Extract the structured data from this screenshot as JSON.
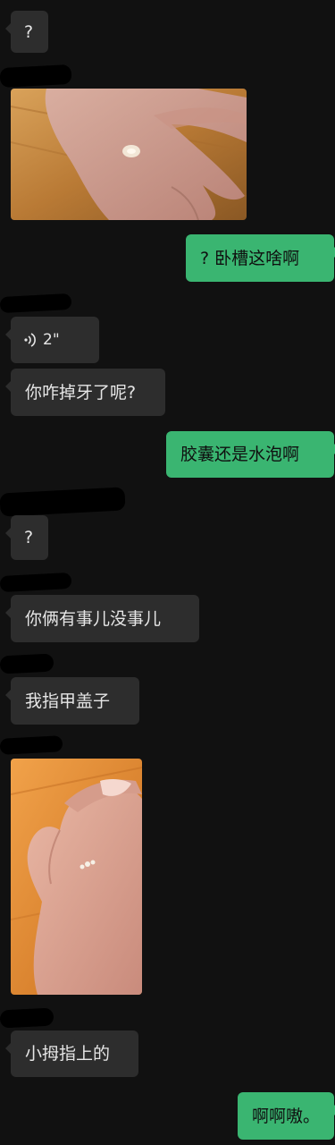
{
  "messages": {
    "m1": {
      "text": "?"
    },
    "m2": {
      "alt": "photo of a palm with a small blister"
    },
    "m3": {
      "text": "? 卧槽这啥啊"
    },
    "m4": {
      "duration": "2\""
    },
    "m5": {
      "text": "你咋掉牙了呢?"
    },
    "m6": {
      "text": "胶囊还是水泡啊"
    },
    "m7": {
      "text": "?"
    },
    "m8": {
      "text": "你俩有事儿没事儿"
    },
    "m9": {
      "text": "我指甲盖子"
    },
    "m10": {
      "alt": "photo of fingers showing a fingernail"
    },
    "m11": {
      "text": "小拇指上的"
    },
    "m12": {
      "text": "啊啊嗷。"
    }
  },
  "colors": {
    "background": "#111111",
    "incoming_bubble": "#2d2d2d",
    "outgoing_bubble": "#3ab571"
  }
}
